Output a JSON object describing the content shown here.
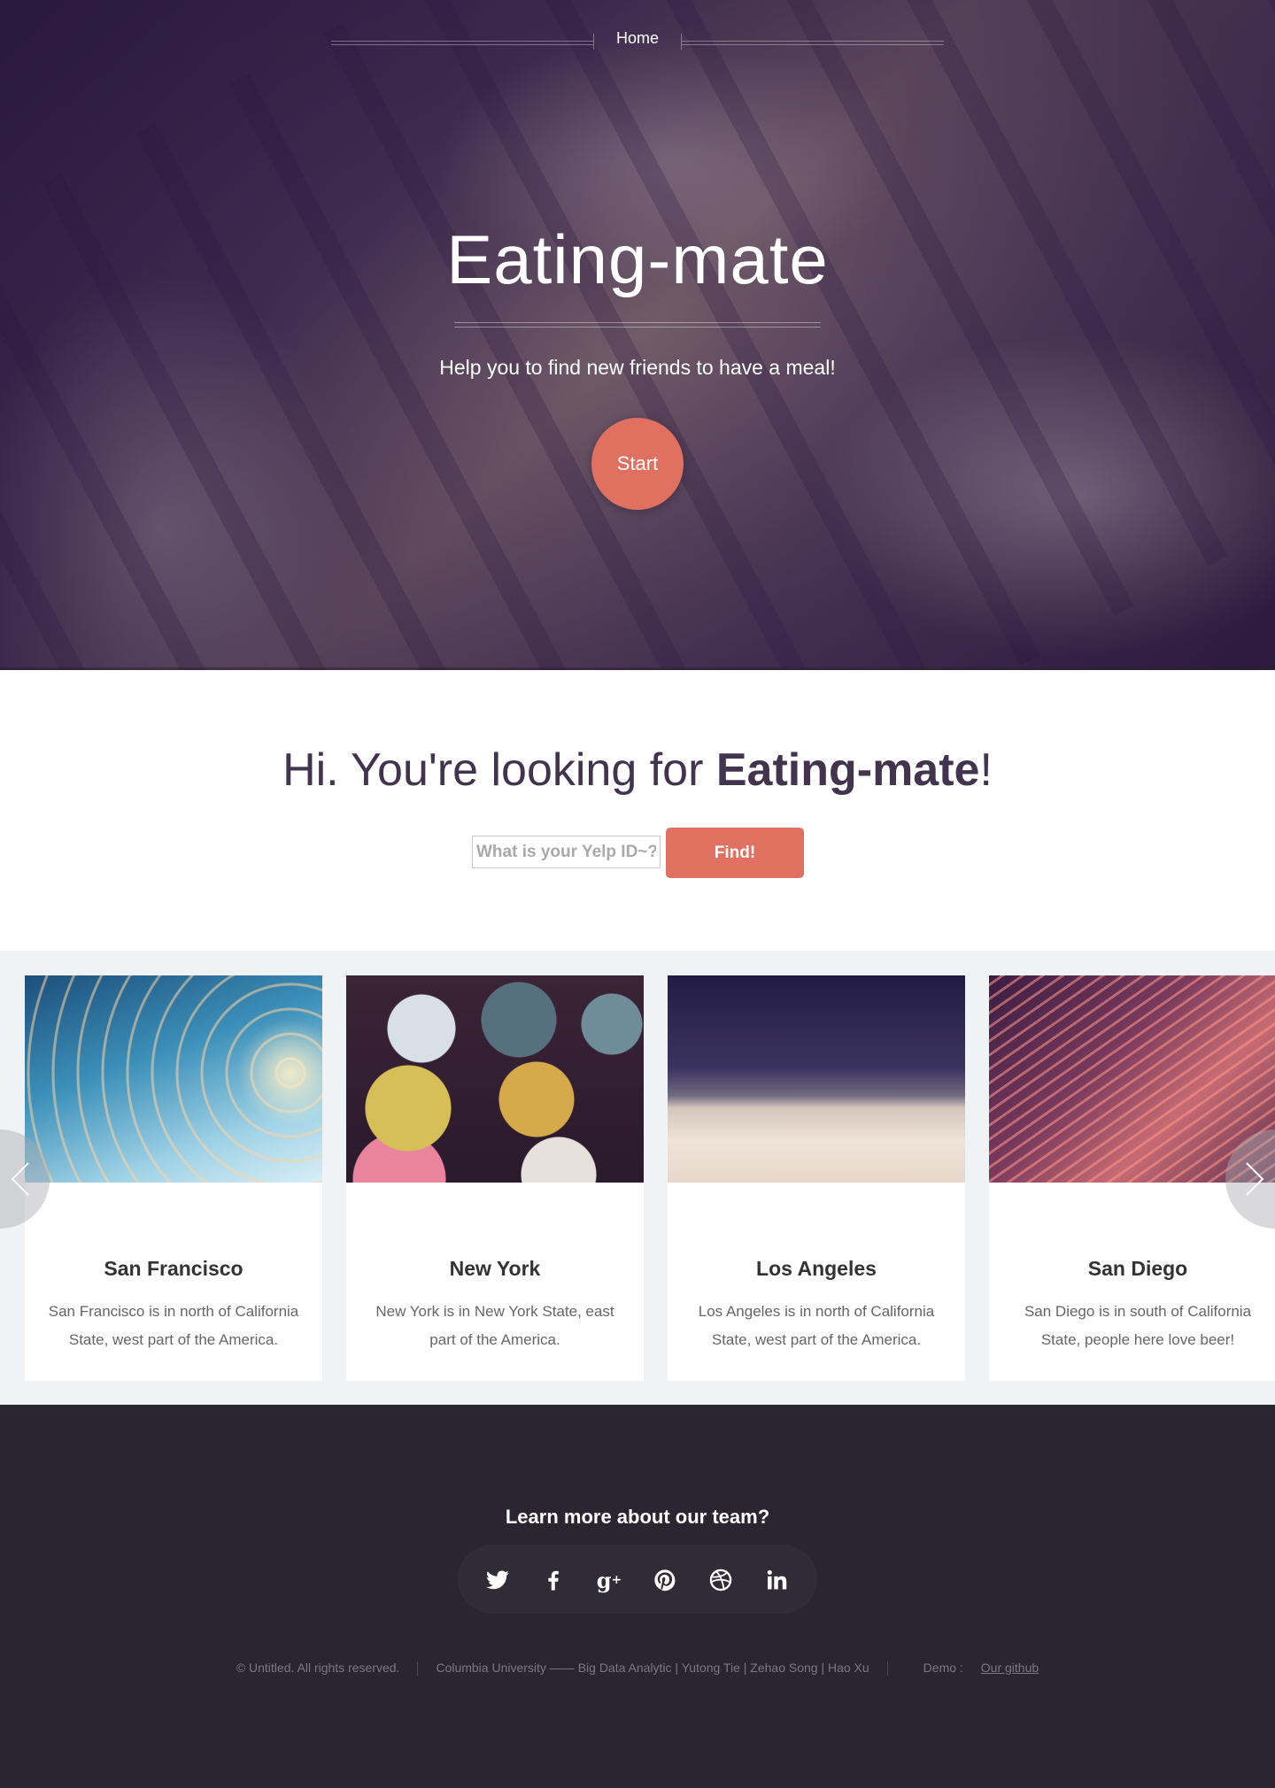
{
  "nav": {
    "home_label": "Home"
  },
  "hero": {
    "title": "Eating-mate",
    "subtitle": "Help you to find new friends to have a meal!",
    "start_label": "Start"
  },
  "intro": {
    "title_prefix": "Hi. You're looking for ",
    "title_bold": "Eating-mate",
    "title_suffix": "!",
    "input_placeholder": "What is your Yelp ID~?",
    "input_value": "",
    "find_label": "Find!"
  },
  "cities": [
    {
      "name": "San Francisco",
      "text": "San Francisco is in north of California State, west part of the America."
    },
    {
      "name": "New York",
      "text": "New York is in New York State, east part of the America."
    },
    {
      "name": "Los Angeles",
      "text": "Los Angeles is in north of California State, west part of the America."
    },
    {
      "name": "San Diego",
      "text": "San Diego is in south of California State, people here love beer!"
    }
  ],
  "footer": {
    "heading": "Learn more about our team?",
    "social_icons": [
      "twitter-icon",
      "facebook-icon",
      "google-plus-icon",
      "pinterest-icon",
      "dribbble-icon",
      "linkedin-icon"
    ],
    "copyright": "© Untitled. All rights reserved.",
    "credits": "Columbia University —— Big Data Analytic | Yutong Tie | Zehao Song | Hao Xu",
    "demo_prefix": "Demo : ",
    "demo_link": "Our github"
  },
  "colors": {
    "accent": "#e0705f",
    "heading": "#42334e",
    "carousel_bg": "#eff3f5",
    "footer_bg": "#2a2530"
  }
}
